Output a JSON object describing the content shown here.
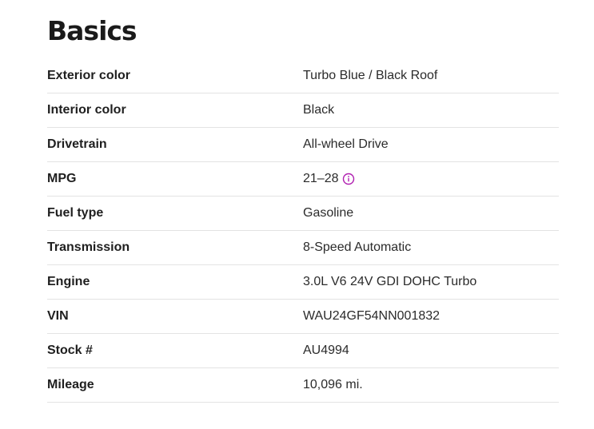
{
  "basics": {
    "title": "Basics",
    "rows": [
      {
        "label": "Exterior color",
        "value": "Turbo Blue / Black Roof"
      },
      {
        "label": "Interior color",
        "value": "Black"
      },
      {
        "label": "Drivetrain",
        "value": "All-wheel Drive"
      },
      {
        "label": "MPG",
        "value": "21–28",
        "icon": "info-icon"
      },
      {
        "label": "Fuel type",
        "value": "Gasoline"
      },
      {
        "label": "Transmission",
        "value": "8-Speed Automatic"
      },
      {
        "label": "Engine",
        "value": "3.0L V6 24V GDI DOHC Turbo"
      },
      {
        "label": "VIN",
        "value": "WAU24GF54NN001832"
      },
      {
        "label": "Stock #",
        "value": "AU4994"
      },
      {
        "label": "Mileage",
        "value": "10,096 mi."
      }
    ]
  },
  "colors": {
    "accent": "#b01fb0",
    "divider": "#e3e3e3"
  }
}
